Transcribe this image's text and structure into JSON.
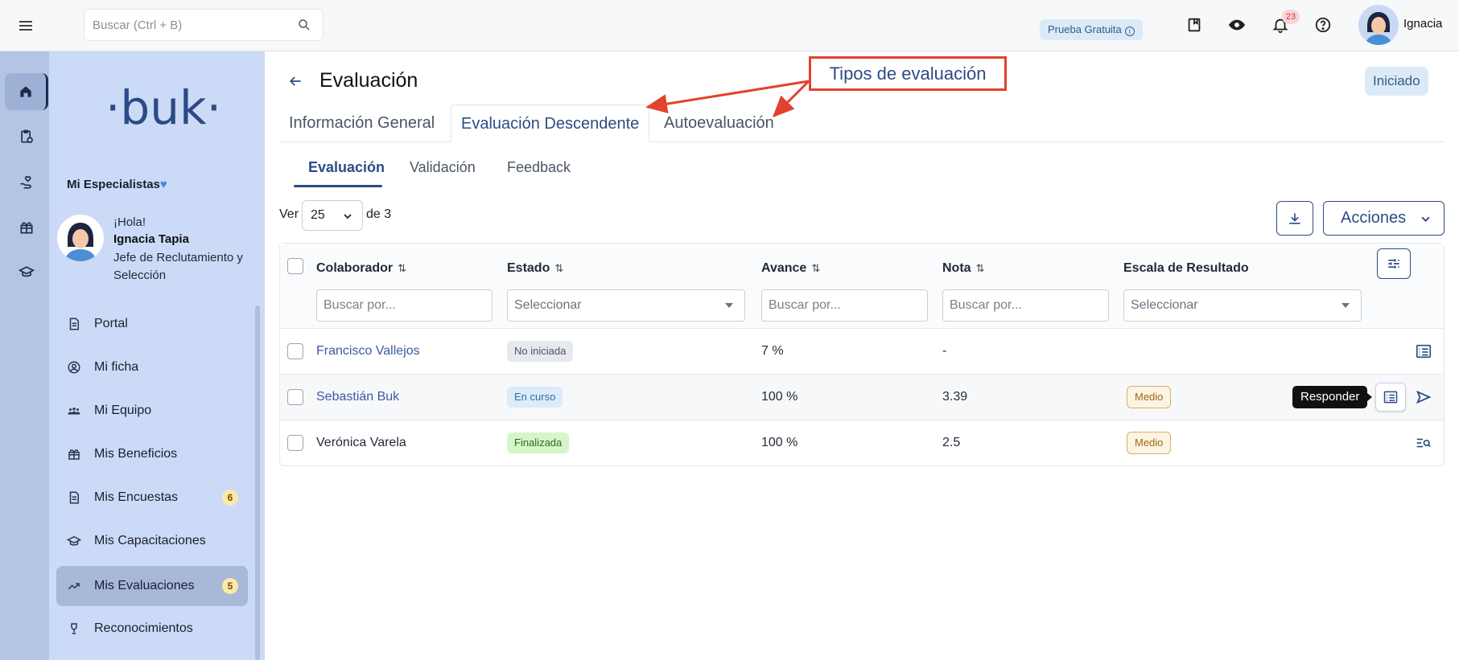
{
  "header": {
    "search_placeholder": "Buscar (Ctrl + B)",
    "trial_label": "Prueba Gratuita",
    "notifications_count": "23",
    "user_name": "Ignacia"
  },
  "sidebar": {
    "logo": "·buk·",
    "group_title": "Mi Especialistas",
    "greeting": "¡Hola!",
    "profile_name": "Ignacia Tapia",
    "profile_role": "Jefe de Reclutamiento y Selección",
    "items": [
      {
        "label": "Portal",
        "icon": "document-icon"
      },
      {
        "label": "Mi ficha",
        "icon": "user-circle-icon"
      },
      {
        "label": "Mi Equipo",
        "icon": "team-icon"
      },
      {
        "label": "Mis Beneficios",
        "icon": "gift-icon"
      },
      {
        "label": "Mis Encuestas",
        "icon": "survey-icon",
        "badge": "6"
      },
      {
        "label": "Mis Capacitaciones",
        "icon": "graduation-cap-icon"
      },
      {
        "label": "Mis Evaluaciones",
        "icon": "trending-icon",
        "badge": "5",
        "active": true
      },
      {
        "label": "Reconocimientos",
        "icon": "trophy-icon"
      }
    ]
  },
  "page": {
    "title": "Evaluación",
    "status": "Iniciado",
    "annotation": "Tipos de evaluación",
    "tabs": [
      "Información General",
      "Evaluación Descendente",
      "Autoevaluación"
    ],
    "active_tab": 1,
    "subtabs": [
      "Evaluación",
      "Validación",
      "Feedback"
    ],
    "active_subtab": 0,
    "page_size_label": "Ver",
    "page_size": "25",
    "total_label": "de 3",
    "actions_label": "Acciones"
  },
  "table": {
    "columns": [
      "Colaborador",
      "Estado",
      "Avance",
      "Nota",
      "Escala de Resultado"
    ],
    "filters": {
      "colaborador": "Buscar por...",
      "estado": "Seleccionar",
      "avance": "Buscar por...",
      "nota": "Buscar por...",
      "escala": "Seleccionar"
    },
    "rows": [
      {
        "colaborador": "Francisco Vallejos",
        "estado": "No iniciada",
        "avance": "7 %",
        "nota": "-",
        "escala": ""
      },
      {
        "colaborador": "Sebastián Buk",
        "estado": "En curso",
        "avance": "100 %",
        "nota": "3.39",
        "escala": "Medio"
      },
      {
        "colaborador": "Verónica Varela",
        "estado": "Finalizada",
        "avance": "100 %",
        "nota": "2.5",
        "escala": "Medio"
      }
    ],
    "tooltip": "Responder"
  },
  "colors": {
    "primary": "#2c4b85",
    "sidebar_bg": "#cbdaf7",
    "rail_bg": "#b3c4e4",
    "annotation": "#e2422e"
  }
}
